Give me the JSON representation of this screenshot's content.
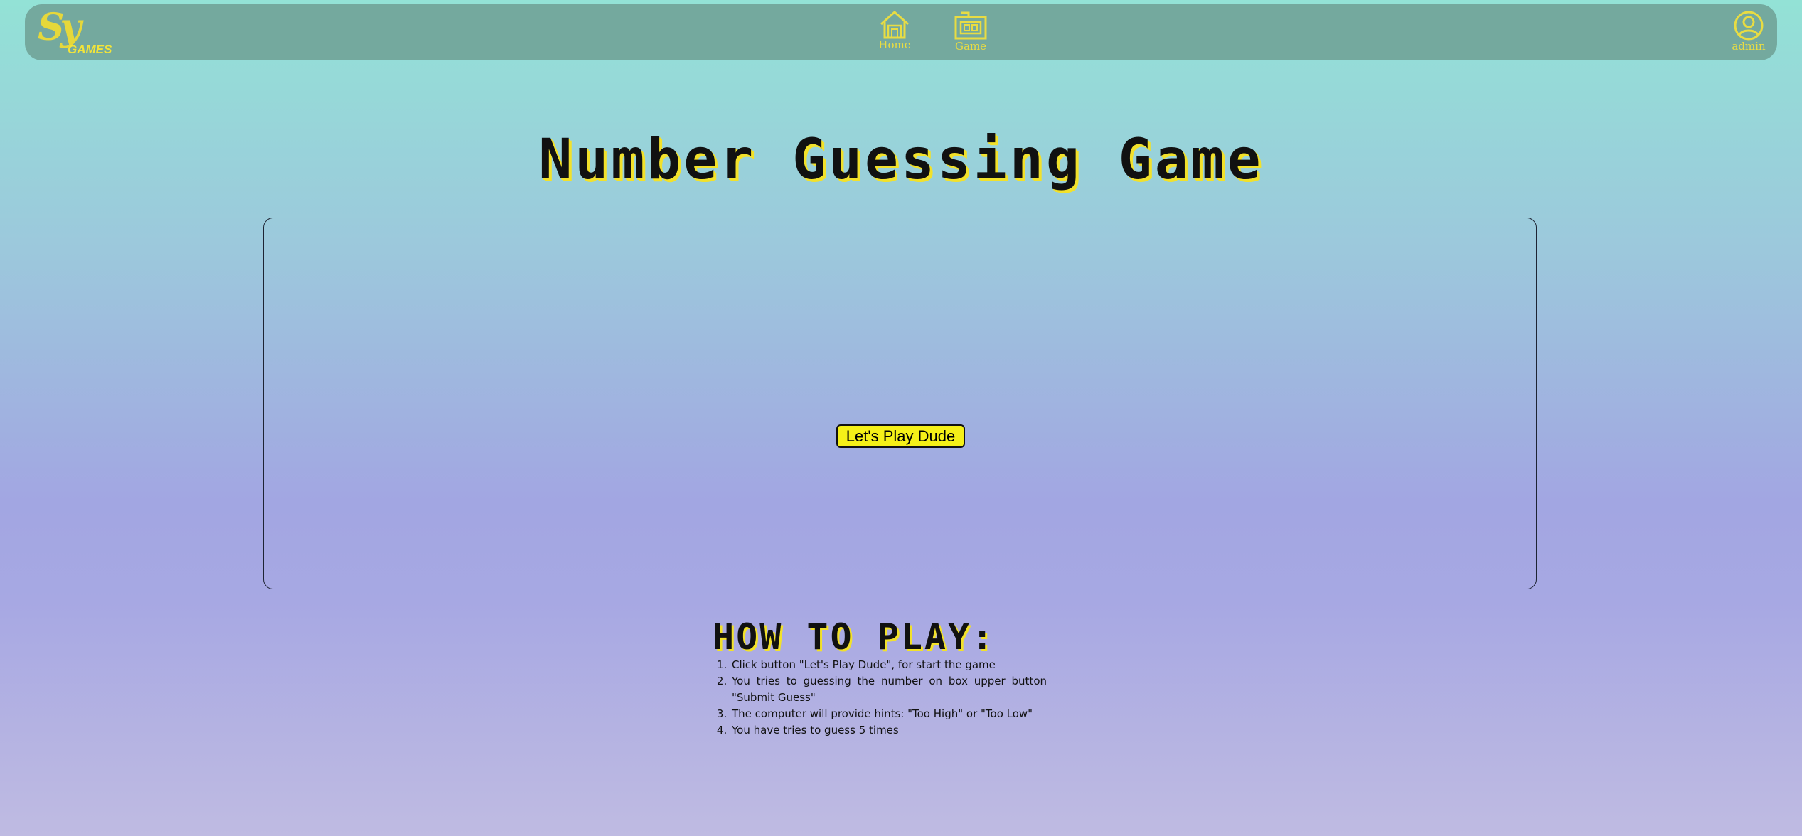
{
  "nav": {
    "logo_letters": "Sy",
    "logo_word": "GAMES",
    "home_label": "Home",
    "game_label": "Game",
    "user_label": "admin",
    "accent_color": "#e8dc43",
    "icons": {
      "home": "home-icon",
      "game": "game-icon",
      "user": "user-icon"
    }
  },
  "main": {
    "title": "Number Guessing Game",
    "play_button_label": "Let's Play Dude"
  },
  "howto": {
    "title": "HOW TO PLAY:",
    "steps": [
      "Click button \"Let's Play Dude\", for start the game",
      "You tries to guessing the number on box upper button \"Submit Guess\"",
      "The computer will provide hints: \"Too High\" or \"Too Low\"",
      "You have tries to guess 5 times"
    ]
  }
}
